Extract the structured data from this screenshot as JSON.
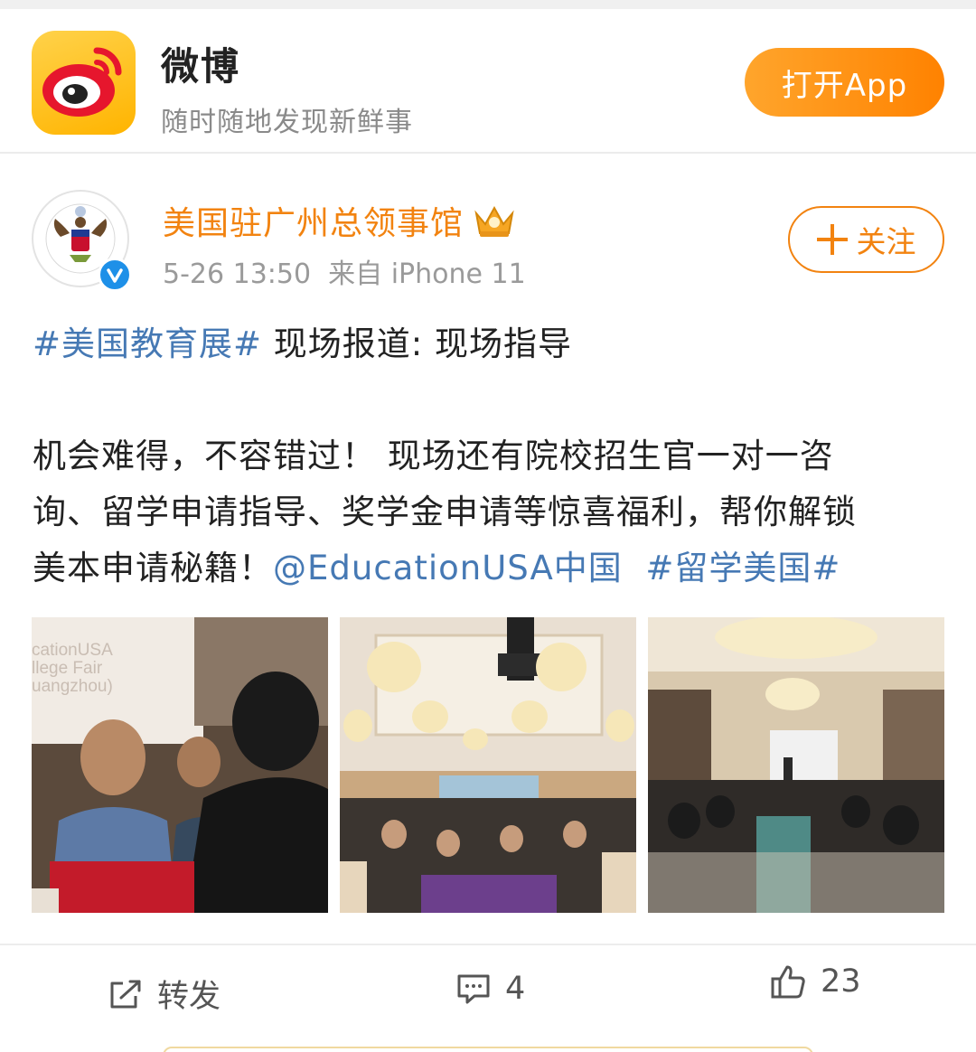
{
  "banner": {
    "app_name": "微博",
    "slogan": "随时随地发现新鲜事",
    "open_app_label": "打开App",
    "brand_color": "#ff8f00"
  },
  "post": {
    "author": "美国驻广州总领事馆",
    "timestamp": "5-26 13:50",
    "source": "来自 iPhone 11",
    "follow_label": "关注",
    "text": {
      "line1_tag": "#美国教育展#",
      "line1_rest": " 现场报道: 现场指导",
      "line2": "机会难得，不容错过！  现场还有院校招生官一对一咨",
      "line3": "询、留学申请指导、奖学金申请等惊喜福利，帮你解锁",
      "line4_plain": "美本申请秘籍！",
      "line4_mention": "@EducationUSA中国",
      "line4_tag": "#留学美国#"
    },
    "photo1_caption_lines": [
      "cationUSA",
      "llege Fair",
      "uangzhou)"
    ],
    "link_color": "#4679b4",
    "author_color": "#f28310"
  },
  "actions": {
    "repost_label": "转发",
    "comment_count": "4",
    "like_count": "23"
  }
}
